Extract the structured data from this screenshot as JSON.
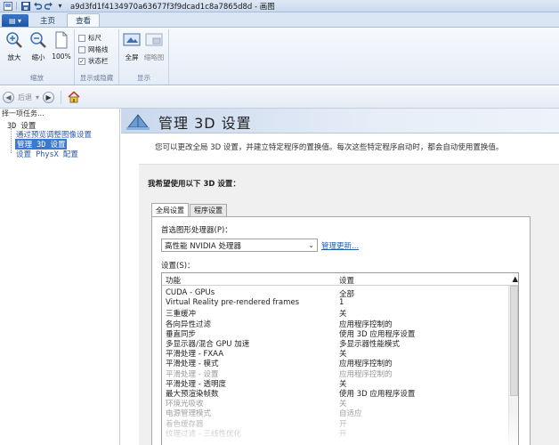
{
  "window": {
    "title": "a9d3fd1f4134970a63677f3f9dcad1c8a7865d8d - 画图"
  },
  "ribbon": {
    "file_label": "▤ ▾",
    "tabs": [
      {
        "label": "主页",
        "active": false
      },
      {
        "label": "查看",
        "active": true
      }
    ],
    "zoom_in": "放大",
    "zoom_out": "缩小",
    "zoom_100": "100%",
    "group_zoom": "缩放",
    "ruler": "标尺",
    "gridlines": "网格线",
    "statusbar": "状态栏",
    "ruler_checked": false,
    "gridlines_checked": false,
    "statusbar_checked": true,
    "group_show": "显示或隐藏",
    "fullscreen": "全屏",
    "thumbnail": "缩略图",
    "group_display": "显示"
  },
  "nav": {
    "back_label": "后退"
  },
  "sidebar": {
    "task_header": "择一项任务...",
    "root": "3D 设置",
    "items": [
      {
        "label": "通过预览调整图像设置",
        "selected": false
      },
      {
        "label": "管理 3D 设置",
        "selected": true
      },
      {
        "label": "设置 PhysX 配置",
        "selected": false
      }
    ]
  },
  "main": {
    "title": "管理 3D 设置",
    "description": "您可以更改全局 3D 设置，并建立特定程序的置换值。每次这些特定程序启动时，都会自动使用置换值。",
    "heading": "我希望使用以下 3D 设置：",
    "tabs": [
      {
        "label": "全局设置",
        "active": true
      },
      {
        "label": "程序设置",
        "active": false
      }
    ],
    "processor_label": "首选图形处理器(P)：",
    "processor_value": "高性能 NVIDIA 处理器",
    "restore_link": "管理更新...",
    "settings_label": "设置(S)：",
    "columns": [
      "功能",
      "设置"
    ],
    "rows": [
      {
        "feature": "CUDA - GPUs",
        "value": "全部",
        "dim": false
      },
      {
        "feature": "Virtual Reality pre-rendered frames",
        "value": "1",
        "dim": false
      },
      {
        "feature": "三重缓冲",
        "value": "关",
        "dim": false
      },
      {
        "feature": "各向异性过滤",
        "value": "应用程序控制的",
        "dim": false
      },
      {
        "feature": "垂直同步",
        "value": "使用 3D 应用程序设置",
        "dim": false
      },
      {
        "feature": "多显示器/混合 GPU 加速",
        "value": "多显示器性能模式",
        "dim": false
      },
      {
        "feature": "平滑处理 - FXAA",
        "value": "关",
        "dim": false
      },
      {
        "feature": "平滑处理 - 模式",
        "value": "应用程序控制的",
        "dim": false
      },
      {
        "feature": "平滑处理 - 设置",
        "value": "应用程序控制的",
        "dim": true
      },
      {
        "feature": "平滑处理 - 透明度",
        "value": "关",
        "dim": false
      },
      {
        "feature": "最大预渲染帧数",
        "value": "使用 3D 应用程序设置",
        "dim": false
      },
      {
        "feature": "环境光吸收",
        "value": "关",
        "dim": true
      },
      {
        "feature": "电源管理模式",
        "value": "自适应",
        "dim": true
      },
      {
        "feature": "着色缓存器",
        "value": "开",
        "dim": true
      },
      {
        "feature": "纹理过滤 - 三线性优化",
        "value": "开",
        "dim": true
      }
    ]
  }
}
